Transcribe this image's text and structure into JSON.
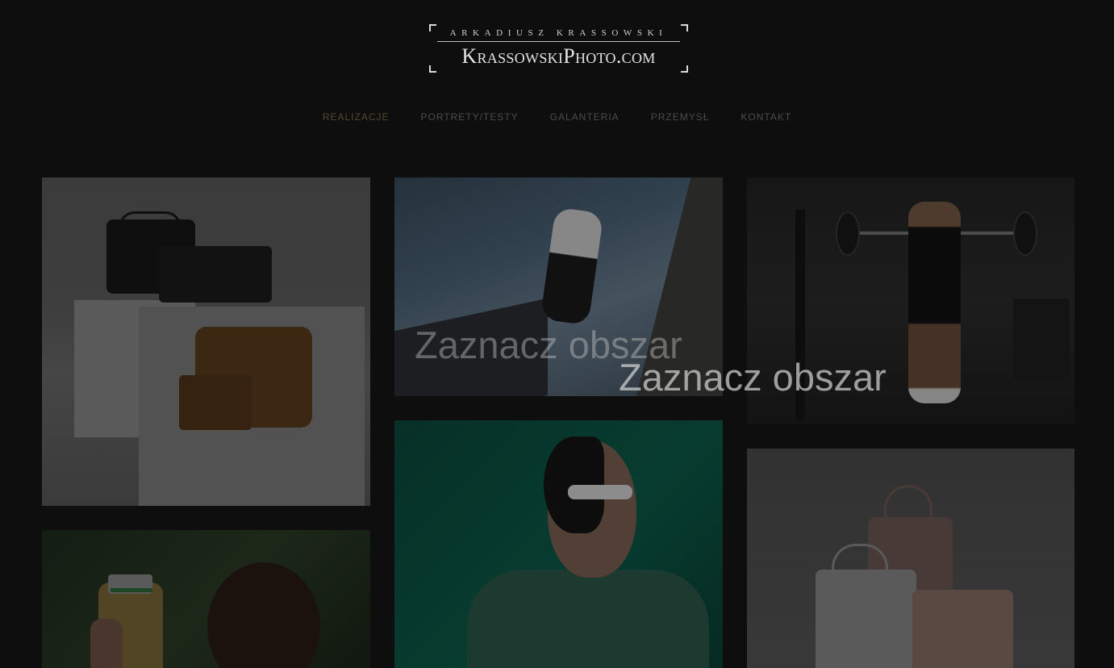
{
  "logo": {
    "tagline": "ARKADIUSZ KRASSOWSKI",
    "wordmark": "KrassowskiPhoto.com"
  },
  "nav": {
    "items": [
      {
        "label": "REALIZACJE",
        "active": true
      },
      {
        "label": "PORTRETY/TESTY",
        "active": false
      },
      {
        "label": "GALANTERIA",
        "active": false
      },
      {
        "label": "PRZEMYSŁ",
        "active": false
      },
      {
        "label": "KONTAKT",
        "active": false
      }
    ]
  },
  "overlay": {
    "text_1": "Zaznacz obszar",
    "text_2": "Zaznacz obszar"
  },
  "colors": {
    "background": "#0e0e0e",
    "nav_active": "#4f4a2f",
    "nav_inactive": "#4c4c4c"
  }
}
